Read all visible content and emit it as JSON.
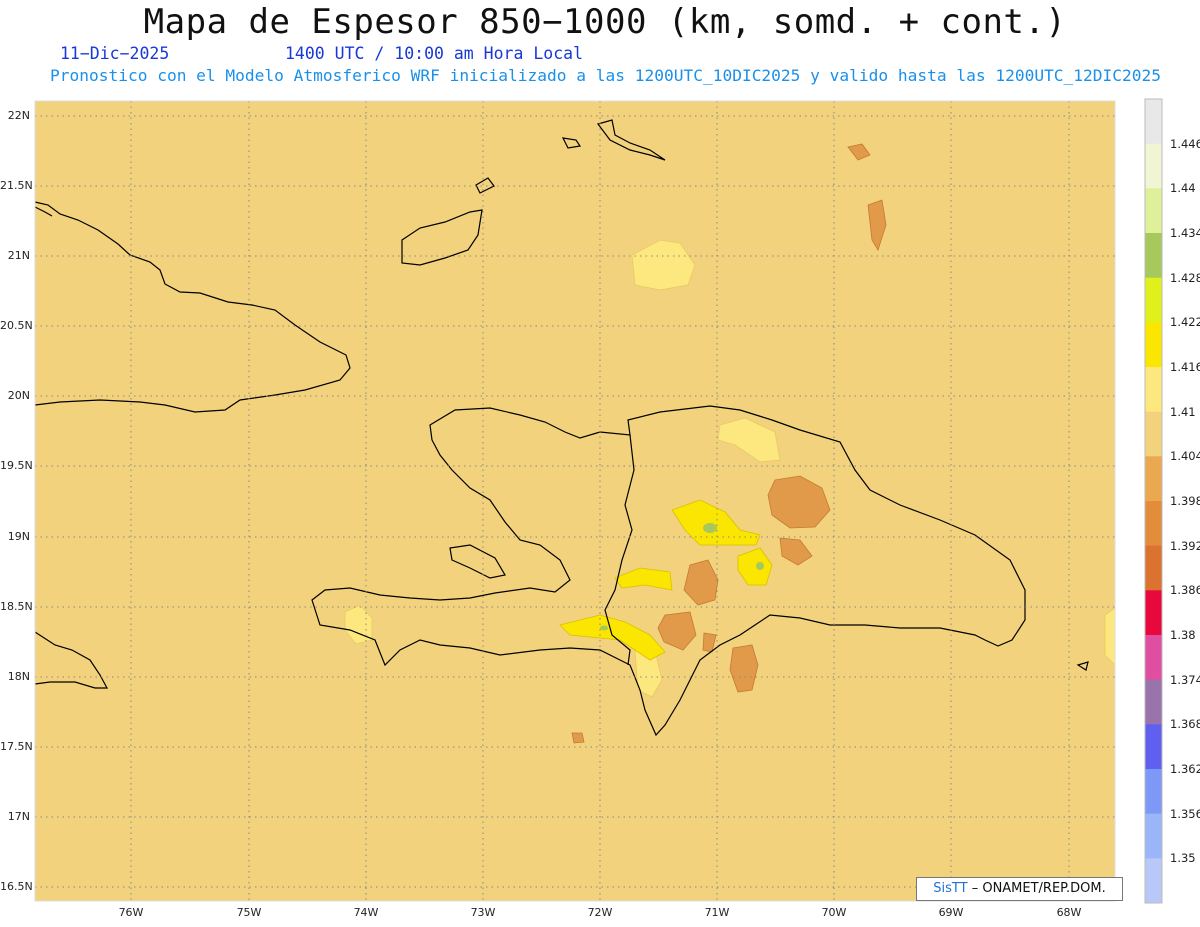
{
  "title": "Mapa de Espesor 850−1000 (km, somd. + cont.)",
  "subtitle_date": "11−Dic−2025",
  "subtitle_time": "1400 UTC / 10:00 am Hora Local",
  "subtitle_model": "Pronostico con el Modelo Atmosferico WRF inicializado a las 1200UTC_10DIC2025 y valido hasta las  1200UTC_12DIC2025",
  "credit_prefix": "SisTT",
  "credit_suffix": "– ONAMET/REP.DOM.",
  "lat_labels": [
    "22N",
    "21.5N",
    "21N",
    "20.5N",
    "20N",
    "19.5N",
    "19N",
    "18.5N",
    "18N",
    "17.5N",
    "17N",
    "16.5N"
  ],
  "lon_labels": [
    "76W",
    "75W",
    "74W",
    "73W",
    "72W",
    "71W",
    "70W",
    "69W",
    "68W"
  ],
  "colorbar": {
    "labels": [
      "1.446",
      "1.44",
      "1.434",
      "1.428",
      "1.422",
      "1.416",
      "1.41",
      "1.404",
      "1.398",
      "1.392",
      "1.386",
      "1.38",
      "1.374",
      "1.368",
      "1.362",
      "1.356",
      "1.35"
    ],
    "colors": [
      "#e8e8e8",
      "#f2f5d4",
      "#dff09a",
      "#a6c85c",
      "#dff01a",
      "#fae600",
      "#fde880",
      "#f3d27d",
      "#eaa850",
      "#e38c3a",
      "#dc7230",
      "#e8083e",
      "#e04ea2",
      "#9a72ac",
      "#6060f0",
      "#7e98f8",
      "#9ab6f8",
      "#b8c8f8"
    ]
  },
  "colors": {
    "background_field": "#f3d27d",
    "title_blue": "#1838d8",
    "subtitle_cyan": "#1a90ea"
  }
}
